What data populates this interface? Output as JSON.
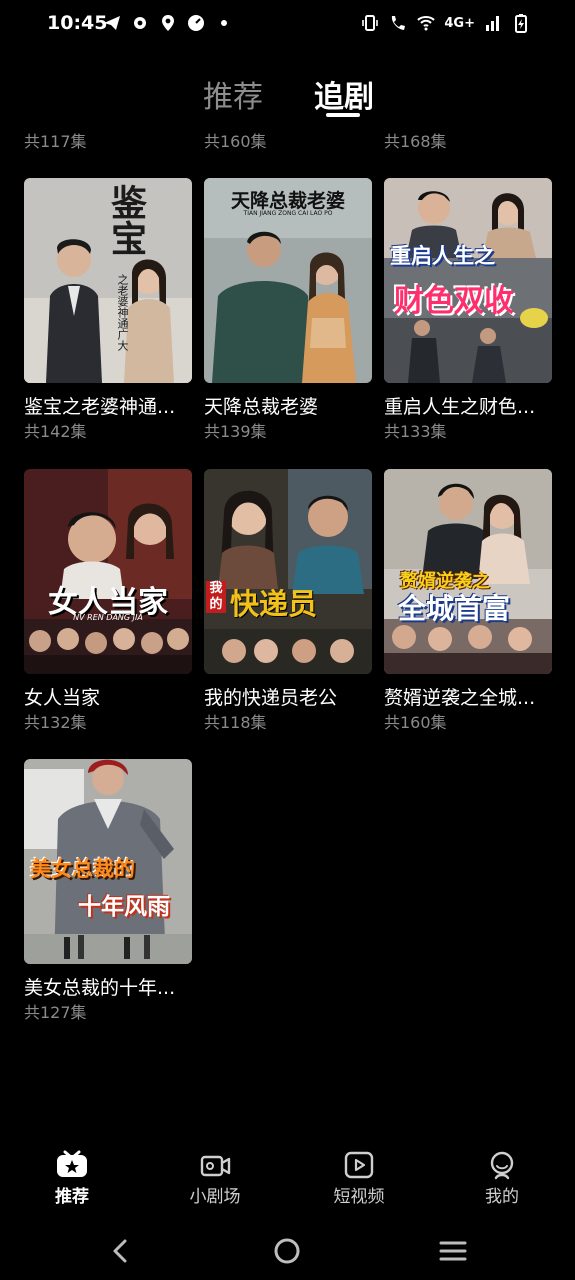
{
  "status_bar": {
    "time": "10:45",
    "left_icons": [
      "telegram-icon",
      "settings-icon",
      "location-icon",
      "speedometer-icon",
      "dot-icon"
    ],
    "right_icons": [
      "vibrate-icon",
      "wifi-call-icon",
      "wifi-icon",
      "network-4g-icon",
      "signal-icon",
      "battery-charging-icon"
    ],
    "network_label": "4G+"
  },
  "top_tabs": {
    "recommend": "推荐",
    "follow": "追剧",
    "active": "follow"
  },
  "ghost_counts": [
    "共117集",
    "共160集",
    "共168集"
  ],
  "dramas": [
    {
      "title": "鉴宝之老婆神通...",
      "count": "共142集",
      "poster_text": "鉴宝",
      "poster_sub": "之老婆神通广大",
      "poster_bg": "#bdbcb8",
      "accent": "#2a2a2a"
    },
    {
      "title": "天降总裁老婆",
      "count": "共139集",
      "poster_text": "天降总裁老婆",
      "poster_sub": "TIAN JIANG ZONG CAI LAO PO",
      "poster_bg": "#9ea6a8",
      "accent": "#1e2a3a"
    },
    {
      "title": "重启人生之财色...",
      "count": "共133集",
      "poster_text": "重启人生之",
      "poster_sub": "财色双收",
      "poster_bg": "#6e7276",
      "accent": "#e0245c"
    },
    {
      "title": "女人当家",
      "count": "共132集",
      "poster_text": "女人当家",
      "poster_sub": "NV REN DANG JIA",
      "poster_bg": "#5a2a2a",
      "accent": "#ffffff"
    },
    {
      "title": "我的快递员老公",
      "count": "共118集",
      "poster_text": "快递员",
      "poster_sub": "我的",
      "poster_bg": "#3c3a32",
      "accent": "#e8b420"
    },
    {
      "title": "赘婿逆袭之全城...",
      "count": "共160集",
      "poster_text": "赘婿逆袭之",
      "poster_sub": "全城首富",
      "poster_bg": "#c9c6c0",
      "accent": "#f0d020"
    },
    {
      "title": "美女总裁的十年...",
      "count": "共127集",
      "poster_text": "美女总裁的",
      "poster_sub": "十年风雨",
      "poster_bg": "#a9aaa6",
      "accent": "#f08a1c"
    }
  ],
  "bottom_nav": [
    {
      "label": "推荐",
      "icon": "recommend-icon",
      "active": true
    },
    {
      "label": "小剧场",
      "icon": "theater-icon",
      "active": false
    },
    {
      "label": "短视频",
      "icon": "short-video-icon",
      "active": false
    },
    {
      "label": "我的",
      "icon": "profile-icon",
      "active": false
    }
  ],
  "system_nav": [
    "back-icon",
    "home-icon",
    "recents-icon"
  ]
}
